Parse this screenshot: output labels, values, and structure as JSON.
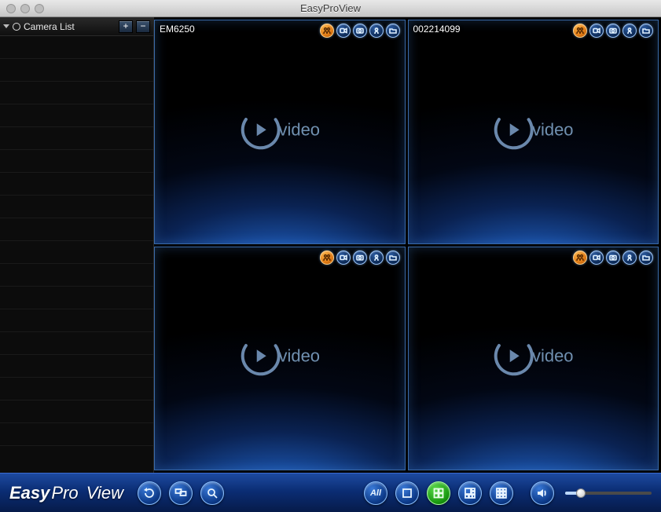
{
  "window": {
    "title": "EasyProView"
  },
  "sidebar": {
    "title": "Camera List",
    "add_label": "+",
    "remove_label": "−"
  },
  "cells": [
    {
      "label": "EM6250",
      "placeholder": "video"
    },
    {
      "label": "002214099",
      "placeholder": "video"
    },
    {
      "label": "",
      "placeholder": "video"
    },
    {
      "label": "",
      "placeholder": "video"
    }
  ],
  "cell_icon_names": [
    "motion-icon",
    "record-icon",
    "snapshot-icon",
    "ptz-icon",
    "folder-icon"
  ],
  "toolbar": {
    "brand1": "Easy",
    "brand2": "Pro",
    "brand3": "View",
    "all_label": "All"
  }
}
